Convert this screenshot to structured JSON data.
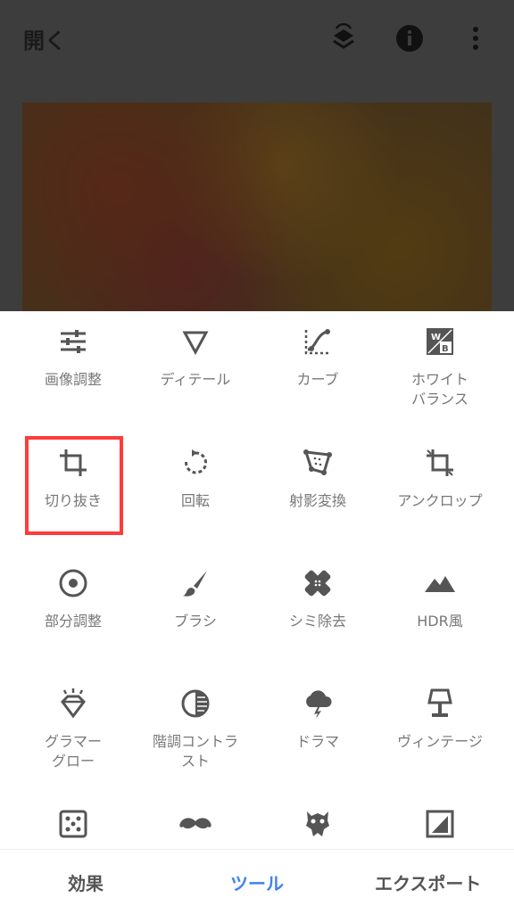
{
  "topbar": {
    "open_label": "開く"
  },
  "tools": [
    {
      "label": "画像調整",
      "icon": "tune-sliders-icon"
    },
    {
      "label": "ディテール",
      "icon": "detail-triangle-icon"
    },
    {
      "label": "カーブ",
      "icon": "curves-icon"
    },
    {
      "label": "ホワイト\nバランス",
      "icon": "white-balance-icon"
    },
    {
      "label": "切り抜き",
      "icon": "crop-icon"
    },
    {
      "label": "回転",
      "icon": "rotate-icon"
    },
    {
      "label": "射影変換",
      "icon": "perspective-icon"
    },
    {
      "label": "アンクロップ",
      "icon": "expand-icon"
    },
    {
      "label": "部分調整",
      "icon": "selective-target-icon"
    },
    {
      "label": "ブラシ",
      "icon": "brush-icon"
    },
    {
      "label": "シミ除去",
      "icon": "healing-bandage-icon"
    },
    {
      "label": "HDR風",
      "icon": "hdr-mountain-icon"
    },
    {
      "label": "グラマー\nグロー",
      "icon": "glamour-diamond-icon"
    },
    {
      "label": "階調コントラ\nスト",
      "icon": "tonal-contrast-icon"
    },
    {
      "label": "ドラマ",
      "icon": "drama-cloud-icon"
    },
    {
      "label": "ヴィンテージ",
      "icon": "vintage-lamp-icon"
    },
    {
      "label": "",
      "icon": "dice-icon"
    },
    {
      "label": "",
      "icon": "mustache-icon"
    },
    {
      "label": "",
      "icon": "grunge-icon"
    },
    {
      "label": "",
      "icon": "frame-icon"
    }
  ],
  "bottom_nav": {
    "effects": "効果",
    "tools": "ツール",
    "export": "エクスポート"
  },
  "colors": {
    "accent": "#3f82f0",
    "highlight": "#ff3b3b",
    "icon": "#555555",
    "label": "#777777"
  }
}
